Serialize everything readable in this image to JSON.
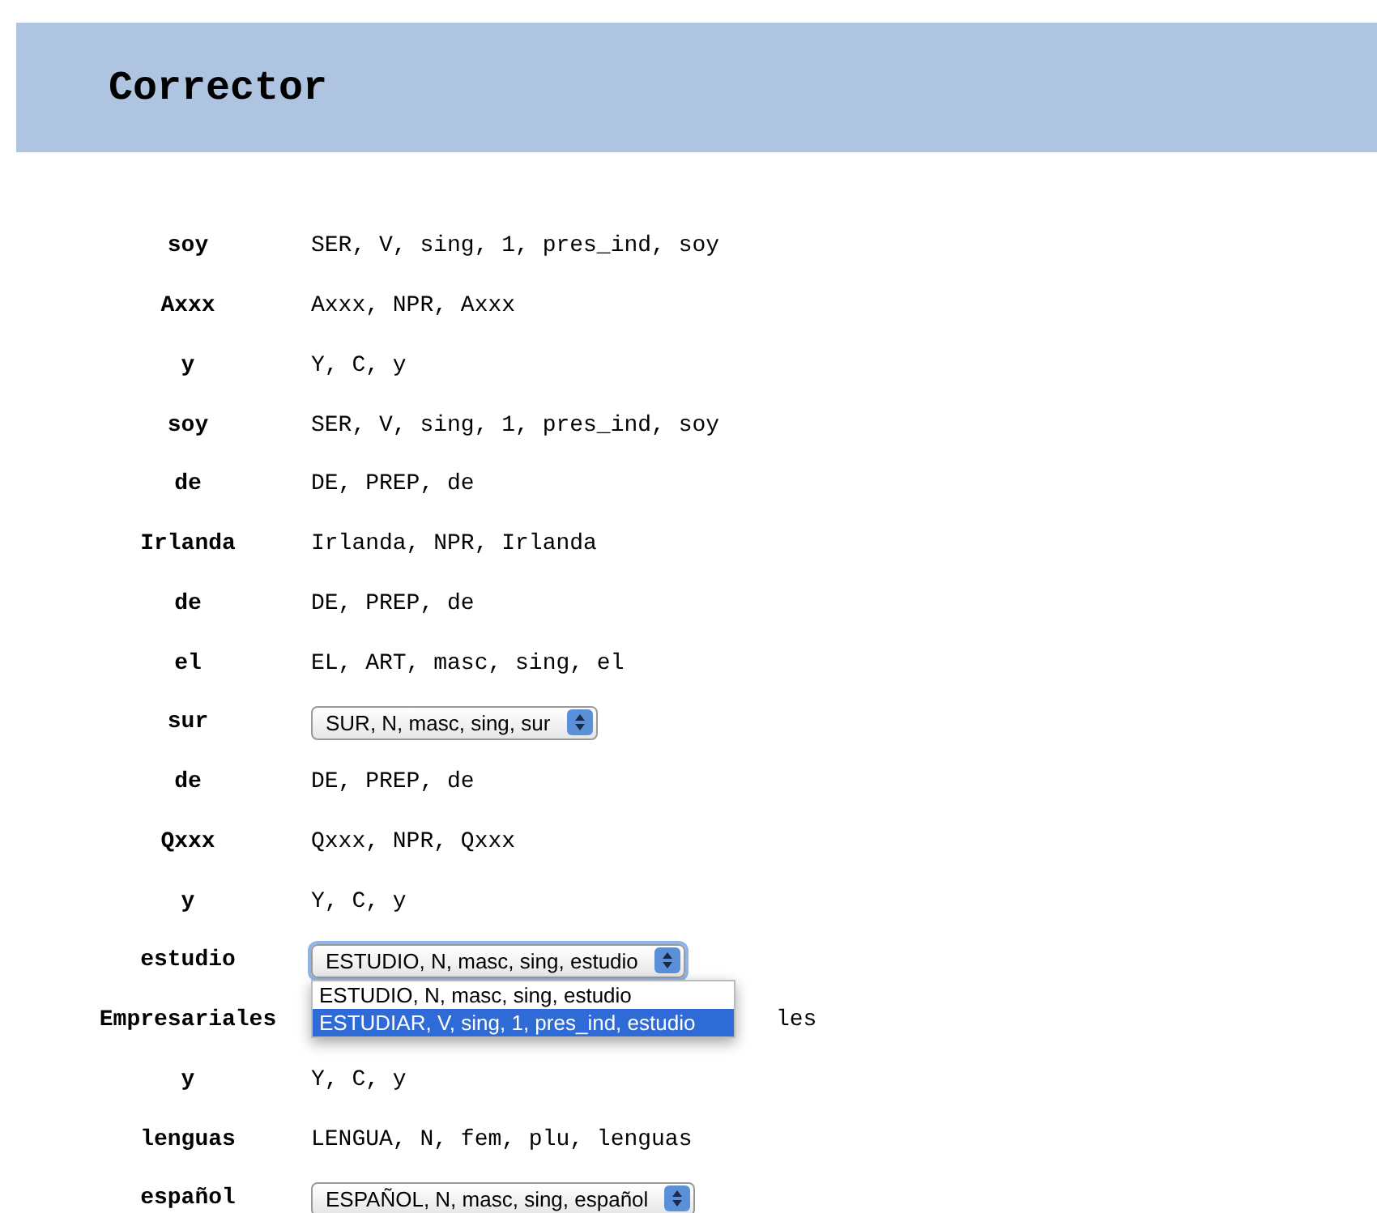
{
  "header": {
    "title": "Corrector"
  },
  "rows": [
    {
      "word": "soy",
      "kind": "text",
      "analysis": "SER, V, sing, 1, pres_ind, soy"
    },
    {
      "word": "Axxx",
      "kind": "text",
      "analysis": "Axxx, NPR, Axxx"
    },
    {
      "word": "y",
      "kind": "text",
      "analysis": "Y, C, y"
    },
    {
      "word": "soy",
      "kind": "text",
      "analysis": "SER, V, sing, 1, pres_ind, soy"
    },
    {
      "word": "de",
      "kind": "text",
      "analysis": "DE, PREP, de"
    },
    {
      "word": "Irlanda",
      "kind": "text",
      "analysis": "Irlanda, NPR, Irlanda"
    },
    {
      "word": "de",
      "kind": "text",
      "analysis": "DE, PREP, de"
    },
    {
      "word": "el",
      "kind": "text",
      "analysis": "EL, ART, masc, sing, el"
    },
    {
      "word": "sur",
      "kind": "select",
      "value": "SUR, N, masc, sing, sur",
      "expanded": false
    },
    {
      "word": "de",
      "kind": "text",
      "analysis": "DE, PREP, de"
    },
    {
      "word": "Qxxx",
      "kind": "text",
      "analysis": "Qxxx, NPR, Qxxx"
    },
    {
      "word": "y",
      "kind": "text",
      "analysis": "Y, C, y"
    },
    {
      "word": "estudio",
      "kind": "select",
      "value": "ESTUDIO, N, masc, sing, estudio",
      "expanded": true,
      "options": [
        {
          "label": "ESTUDIO, N, masc, sing, estudio",
          "highlighted": false
        },
        {
          "label": "ESTUDIAR, V, sing, 1, pres_ind, estudio",
          "highlighted": true
        }
      ]
    },
    {
      "word": "Empresariales",
      "kind": "covered",
      "analysis": "les"
    },
    {
      "word": "y",
      "kind": "text",
      "analysis": "Y, C, y"
    },
    {
      "word": "lenguas",
      "kind": "text",
      "analysis": "LENGUA, N, fem, plu, lenguas"
    },
    {
      "word": "español",
      "kind": "select",
      "value": "ESPAÑOL, N, masc, sing, español",
      "expanded": false
    }
  ]
}
